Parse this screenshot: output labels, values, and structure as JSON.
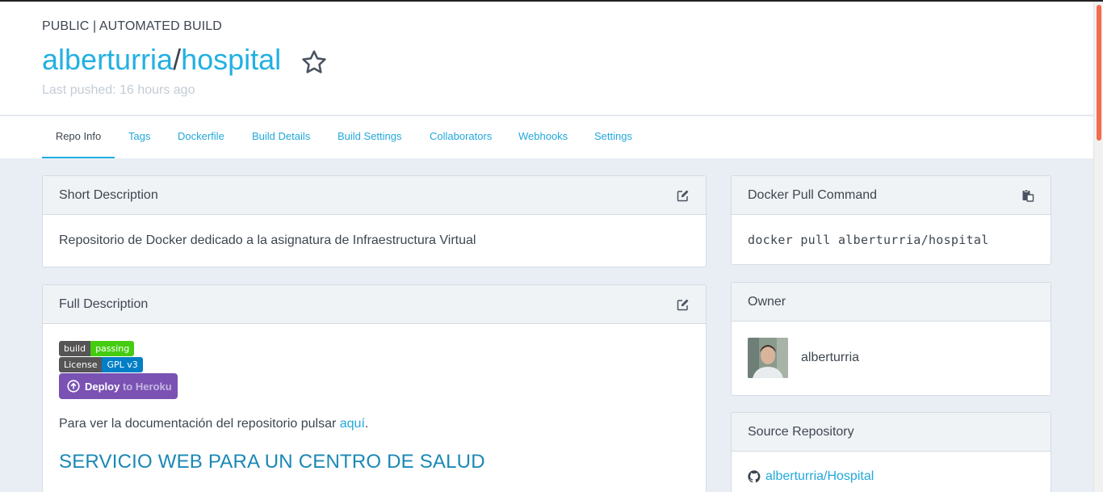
{
  "header": {
    "build_type": "PUBLIC | AUTOMATED BUILD",
    "owner_name": "alberturria",
    "separator": "/",
    "repo_name": "hospital",
    "last_pushed": "Last pushed: 16 hours ago",
    "star_icon": "star-outline-icon"
  },
  "tabs": [
    {
      "label": "Repo Info",
      "active": true
    },
    {
      "label": "Tags"
    },
    {
      "label": "Dockerfile"
    },
    {
      "label": "Build Details"
    },
    {
      "label": "Build Settings"
    },
    {
      "label": "Collaborators"
    },
    {
      "label": "Webhooks"
    },
    {
      "label": "Settings"
    }
  ],
  "short_description": {
    "title": "Short Description",
    "text": "Repositorio de Docker dedicado a la asignatura de Infraestructura Virtual",
    "icon": "edit-icon"
  },
  "full_description": {
    "title": "Full Description",
    "icon": "edit-icon",
    "badges": {
      "build_left": "build",
      "build_right": "passing",
      "license_left": "License",
      "license_right": "GPL v3",
      "deploy_main": "Deploy",
      "deploy_to": "to Heroku"
    },
    "doc_text": "Para ver la documentación del repositorio pulsar ",
    "doc_link": "aquí",
    "doc_end": ".",
    "heading": "SERVICIO WEB PARA UN CENTRO DE SALUD"
  },
  "pull_command": {
    "title": "Docker Pull Command",
    "command": "docker pull alberturria/hospital",
    "icon": "clipboard-icon"
  },
  "owner": {
    "title": "Owner",
    "name": "alberturria"
  },
  "source_repo": {
    "title": "Source Repository",
    "link": "alberturria/Hospital",
    "icon": "github-icon"
  },
  "colors": {
    "accent": "#22b0e2",
    "background": "#e9eef4",
    "scroll_thumb": "#f26c4f"
  }
}
